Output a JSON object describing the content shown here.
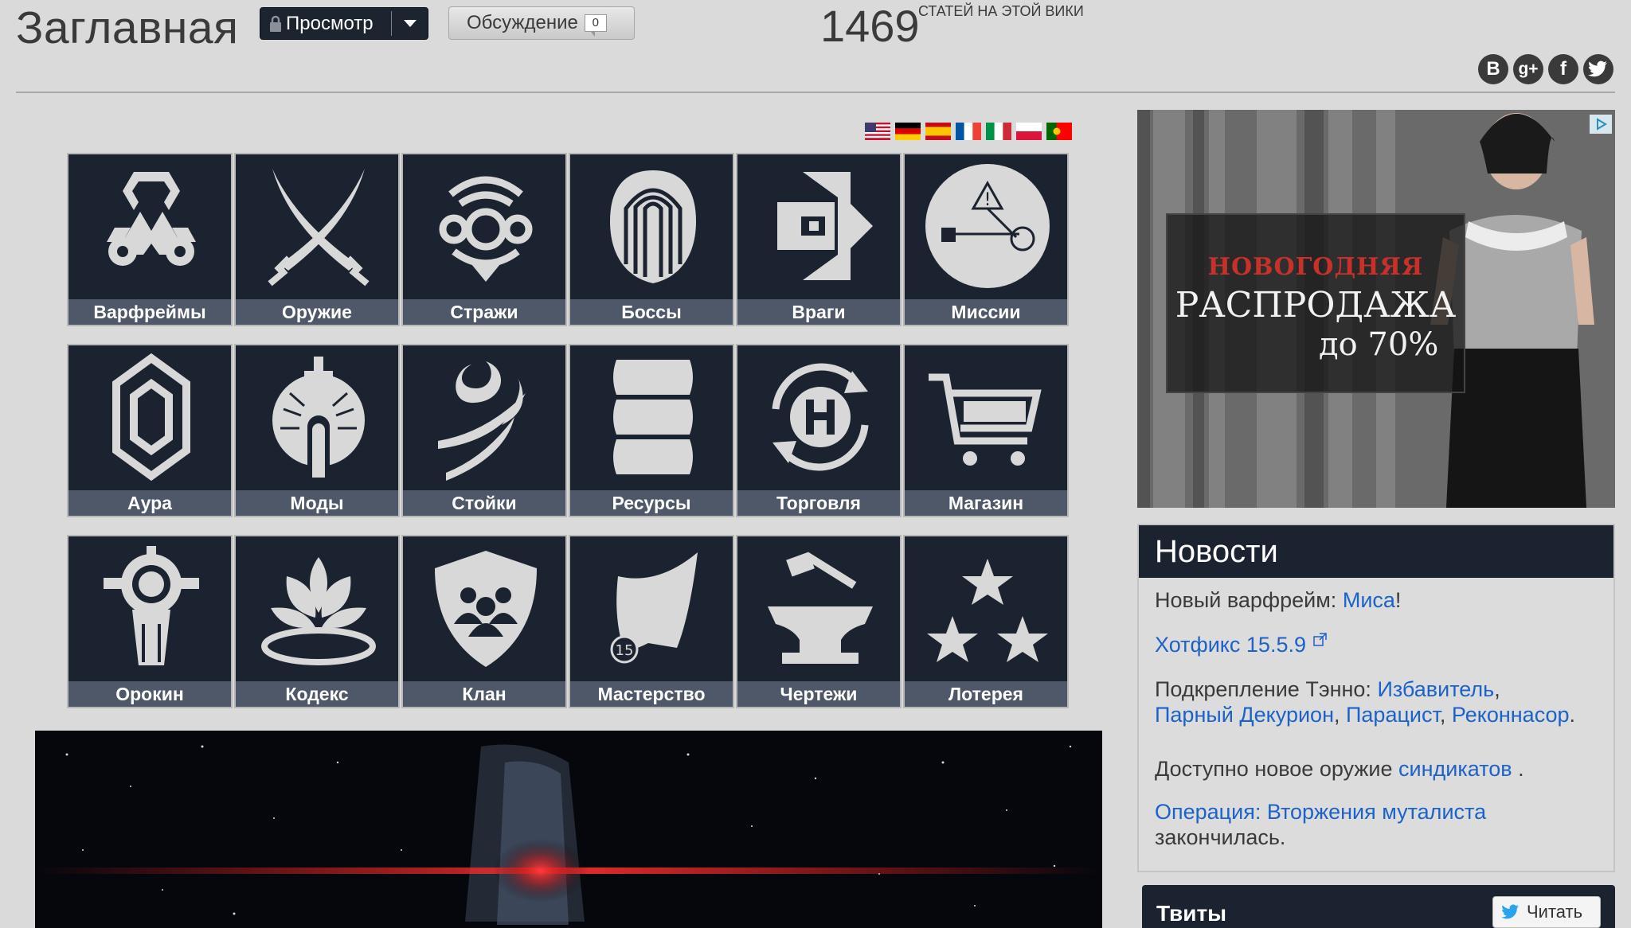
{
  "header": {
    "title": "Заглавная",
    "view_button": "Просмотр",
    "talk_button": "Обсуждение",
    "talk_count": "0",
    "articles_count": "1469",
    "articles_label": "СТАТЕЙ НА ЭТОЙ ВИКИ"
  },
  "social": [
    "B",
    "g+",
    "f",
    "t"
  ],
  "flags": [
    "us",
    "de",
    "es",
    "fr",
    "it",
    "pl",
    "pt"
  ],
  "tiles": [
    {
      "label": "Варфреймы",
      "icon": "warframe-icon"
    },
    {
      "label": "Оружие",
      "icon": "crossed-swords-icon"
    },
    {
      "label": "Стражи",
      "icon": "sentinel-icon"
    },
    {
      "label": "Боссы",
      "icon": "boss-mask-icon"
    },
    {
      "label": "Враги",
      "icon": "enemy-icon"
    },
    {
      "label": "Миссии",
      "icon": "mission-globe-icon"
    },
    {
      "label": "Аура",
      "icon": "aura-crystal-icon"
    },
    {
      "label": "Моды",
      "icon": "mod-icon"
    },
    {
      "label": "Стойки",
      "icon": "stance-icon"
    },
    {
      "label": "Ресурсы",
      "icon": "resource-barrel-icon"
    },
    {
      "label": "Торговля",
      "icon": "trade-cycle-icon"
    },
    {
      "label": "Магазин",
      "icon": "shopping-cart-icon"
    },
    {
      "label": "Орокин",
      "icon": "orokin-icon"
    },
    {
      "label": "Кодекс",
      "icon": "lotus-icon"
    },
    {
      "label": "Клан",
      "icon": "clan-shield-icon"
    },
    {
      "label": "Мастерство",
      "icon": "mastery-icon"
    },
    {
      "label": "Чертежи",
      "icon": "anvil-hammer-icon"
    },
    {
      "label": "Лотерея",
      "icon": "stars-icon"
    }
  ],
  "ad": {
    "line1": "НОВОГОДНЯЯ",
    "line2": "РАСПРОДАЖА",
    "line3": "до 70%"
  },
  "news": {
    "title": "Новости",
    "item1_text": "Новый варфрейм: ",
    "item1_link": "Миса",
    "item1_end": "!",
    "item2_link": "Хотфикс 15.5.9",
    "item3_text": "Подкрепление Тэнно: ",
    "item3_link1": "Избавитель",
    "item3_link2": "Парный Декурион",
    "item3_link3": "Парацист",
    "item3_link4": "Реконнасор",
    "item4_text": "Доступно новое оружие ",
    "item4_link": "синдикатов",
    "item4_end": " .",
    "item5_link": "Операция: Вторжения муталиста",
    "item5_text": "закончилась."
  },
  "tweets": {
    "title": "Твиты",
    "button": "Читать"
  }
}
